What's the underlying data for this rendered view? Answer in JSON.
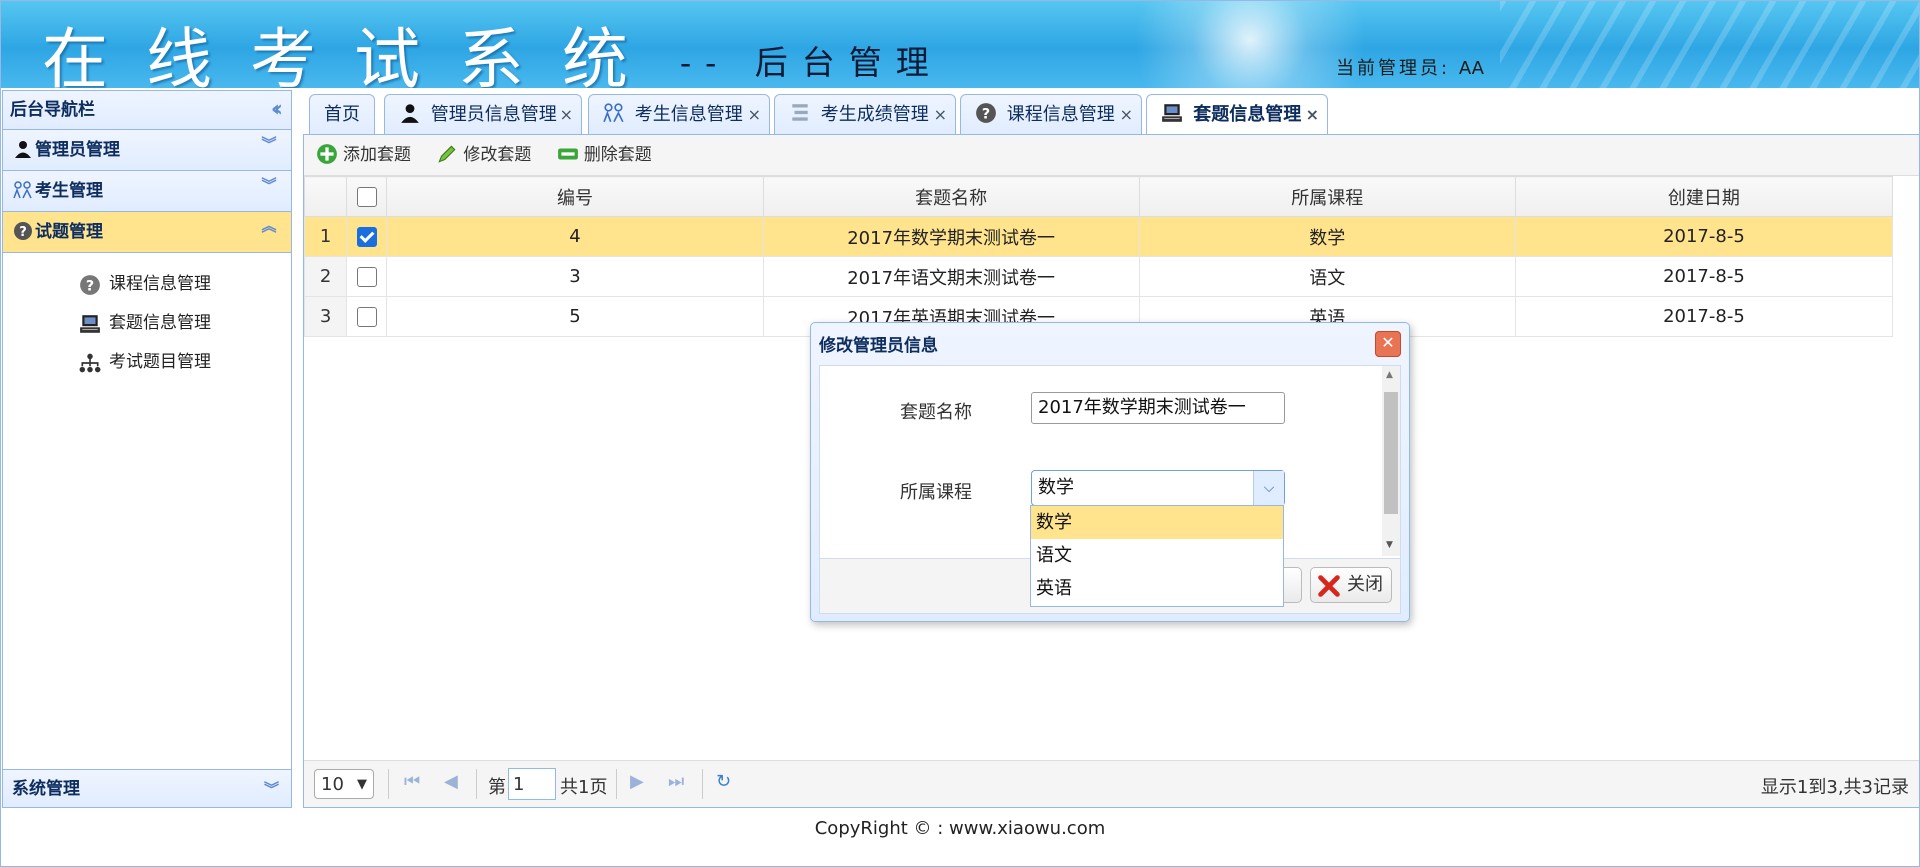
{
  "header": {
    "title": "在线考试系统",
    "subtitle": "-- 后台管理",
    "admin_label": "当前管理员:",
    "admin_name": "AA"
  },
  "sidebar": {
    "title": "后台导航栏",
    "groups": [
      {
        "label": "管理员管理",
        "icon": "user-icon"
      },
      {
        "label": "考生管理",
        "icon": "students-icon"
      },
      {
        "label": "试题管理",
        "icon": "question-icon",
        "expanded": true
      }
    ],
    "sub_items": [
      {
        "label": "课程信息管理",
        "icon": "question-icon"
      },
      {
        "label": "套题信息管理",
        "icon": "computer-icon"
      },
      {
        "label": "考试题目管理",
        "icon": "tree-icon"
      }
    ],
    "bottom_group": "系统管理"
  },
  "tabs": [
    {
      "label": "首页"
    },
    {
      "label": "管理员信息管理",
      "icon": "user-icon"
    },
    {
      "label": "考生信息管理",
      "icon": "students-icon"
    },
    {
      "label": "考生成绩管理",
      "icon": "list-icon"
    },
    {
      "label": "课程信息管理",
      "icon": "question-icon"
    },
    {
      "label": "套题信息管理",
      "icon": "computer-icon",
      "active": true
    }
  ],
  "toolbar": {
    "add": "添加套题",
    "edit": "修改套题",
    "delete": "删除套题"
  },
  "grid": {
    "columns": [
      "编号",
      "套题名称",
      "所属课程",
      "创建日期"
    ],
    "rows": [
      {
        "rownum": "1",
        "id": "4",
        "name": "2017年数学期末测试卷一",
        "course": "数学",
        "date": "2017-8-5",
        "checked": true
      },
      {
        "rownum": "2",
        "id": "3",
        "name": "2017年语文期末测试卷一",
        "course": "语文",
        "date": "2017-8-5",
        "checked": false
      },
      {
        "rownum": "3",
        "id": "5",
        "name": "2017年英语期末测试卷一",
        "course": "英语",
        "date": "2017-8-5",
        "checked": false
      }
    ]
  },
  "pager": {
    "page_size": "10",
    "page_prefix": "第",
    "page_value": "1",
    "page_total": "共1页",
    "info": "显示1到3,共3记录"
  },
  "dialog": {
    "title": "修改管理员信息",
    "name_label": "套题名称",
    "name_value": "2017年数学期末测试卷一",
    "course_label": "所属课程",
    "course_value": "数学",
    "course_options": [
      "数学",
      "语文",
      "英语"
    ],
    "close_button": "关闭"
  },
  "footer": {
    "copyright": "CopyRight © : www.xiaowu.com"
  },
  "colors": {
    "header_blue": "#2ea6e4",
    "selection_yellow": "#ffe48d",
    "border_blue": "#95b8e7"
  }
}
